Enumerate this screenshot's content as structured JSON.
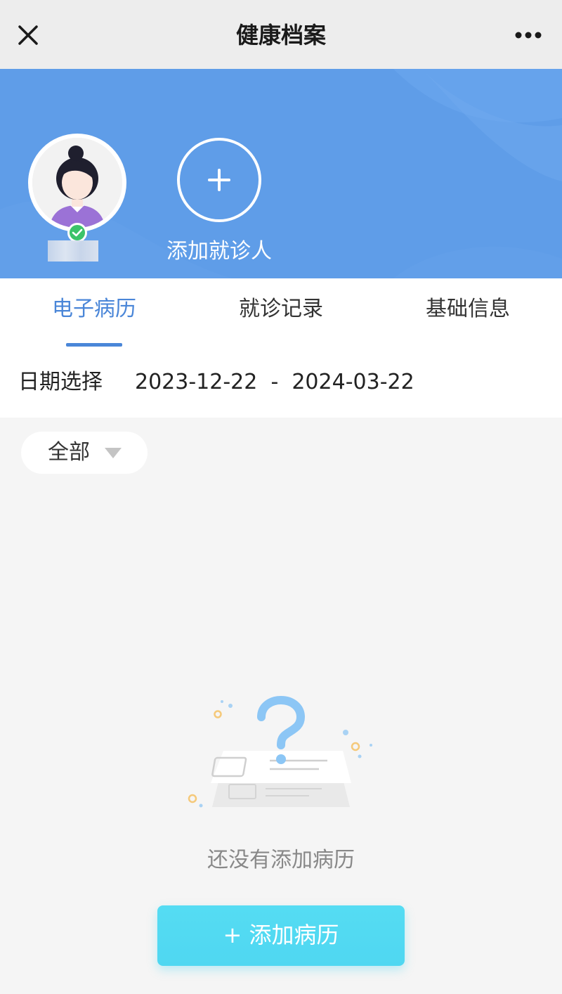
{
  "header": {
    "title": "健康档案",
    "close_icon": "close-icon",
    "more_icon": "more-horizontal-icon"
  },
  "banner": {
    "background_color": "#5f9de8",
    "add_patient_label": "添加就诊人",
    "add_icon": "plus-icon",
    "verified_icon": "check-icon",
    "verified_color": "#3cc36a"
  },
  "tabs": [
    {
      "label": "电子病历",
      "active": true
    },
    {
      "label": "就诊记录",
      "active": false
    },
    {
      "label": "基础信息",
      "active": false
    }
  ],
  "accent_color": "#4a86d8",
  "date_filter": {
    "label": "日期选择",
    "start": "2023-12-22",
    "separator": "-",
    "end": "2024-03-22"
  },
  "category_filter": {
    "selected": "全部",
    "icon": "caret-down-icon"
  },
  "empty_state": {
    "icon": "question-document-illustration",
    "message": "还没有添加病历"
  },
  "add_record_button": {
    "label": "+ 添加病历",
    "color": "#4fd7f1"
  }
}
